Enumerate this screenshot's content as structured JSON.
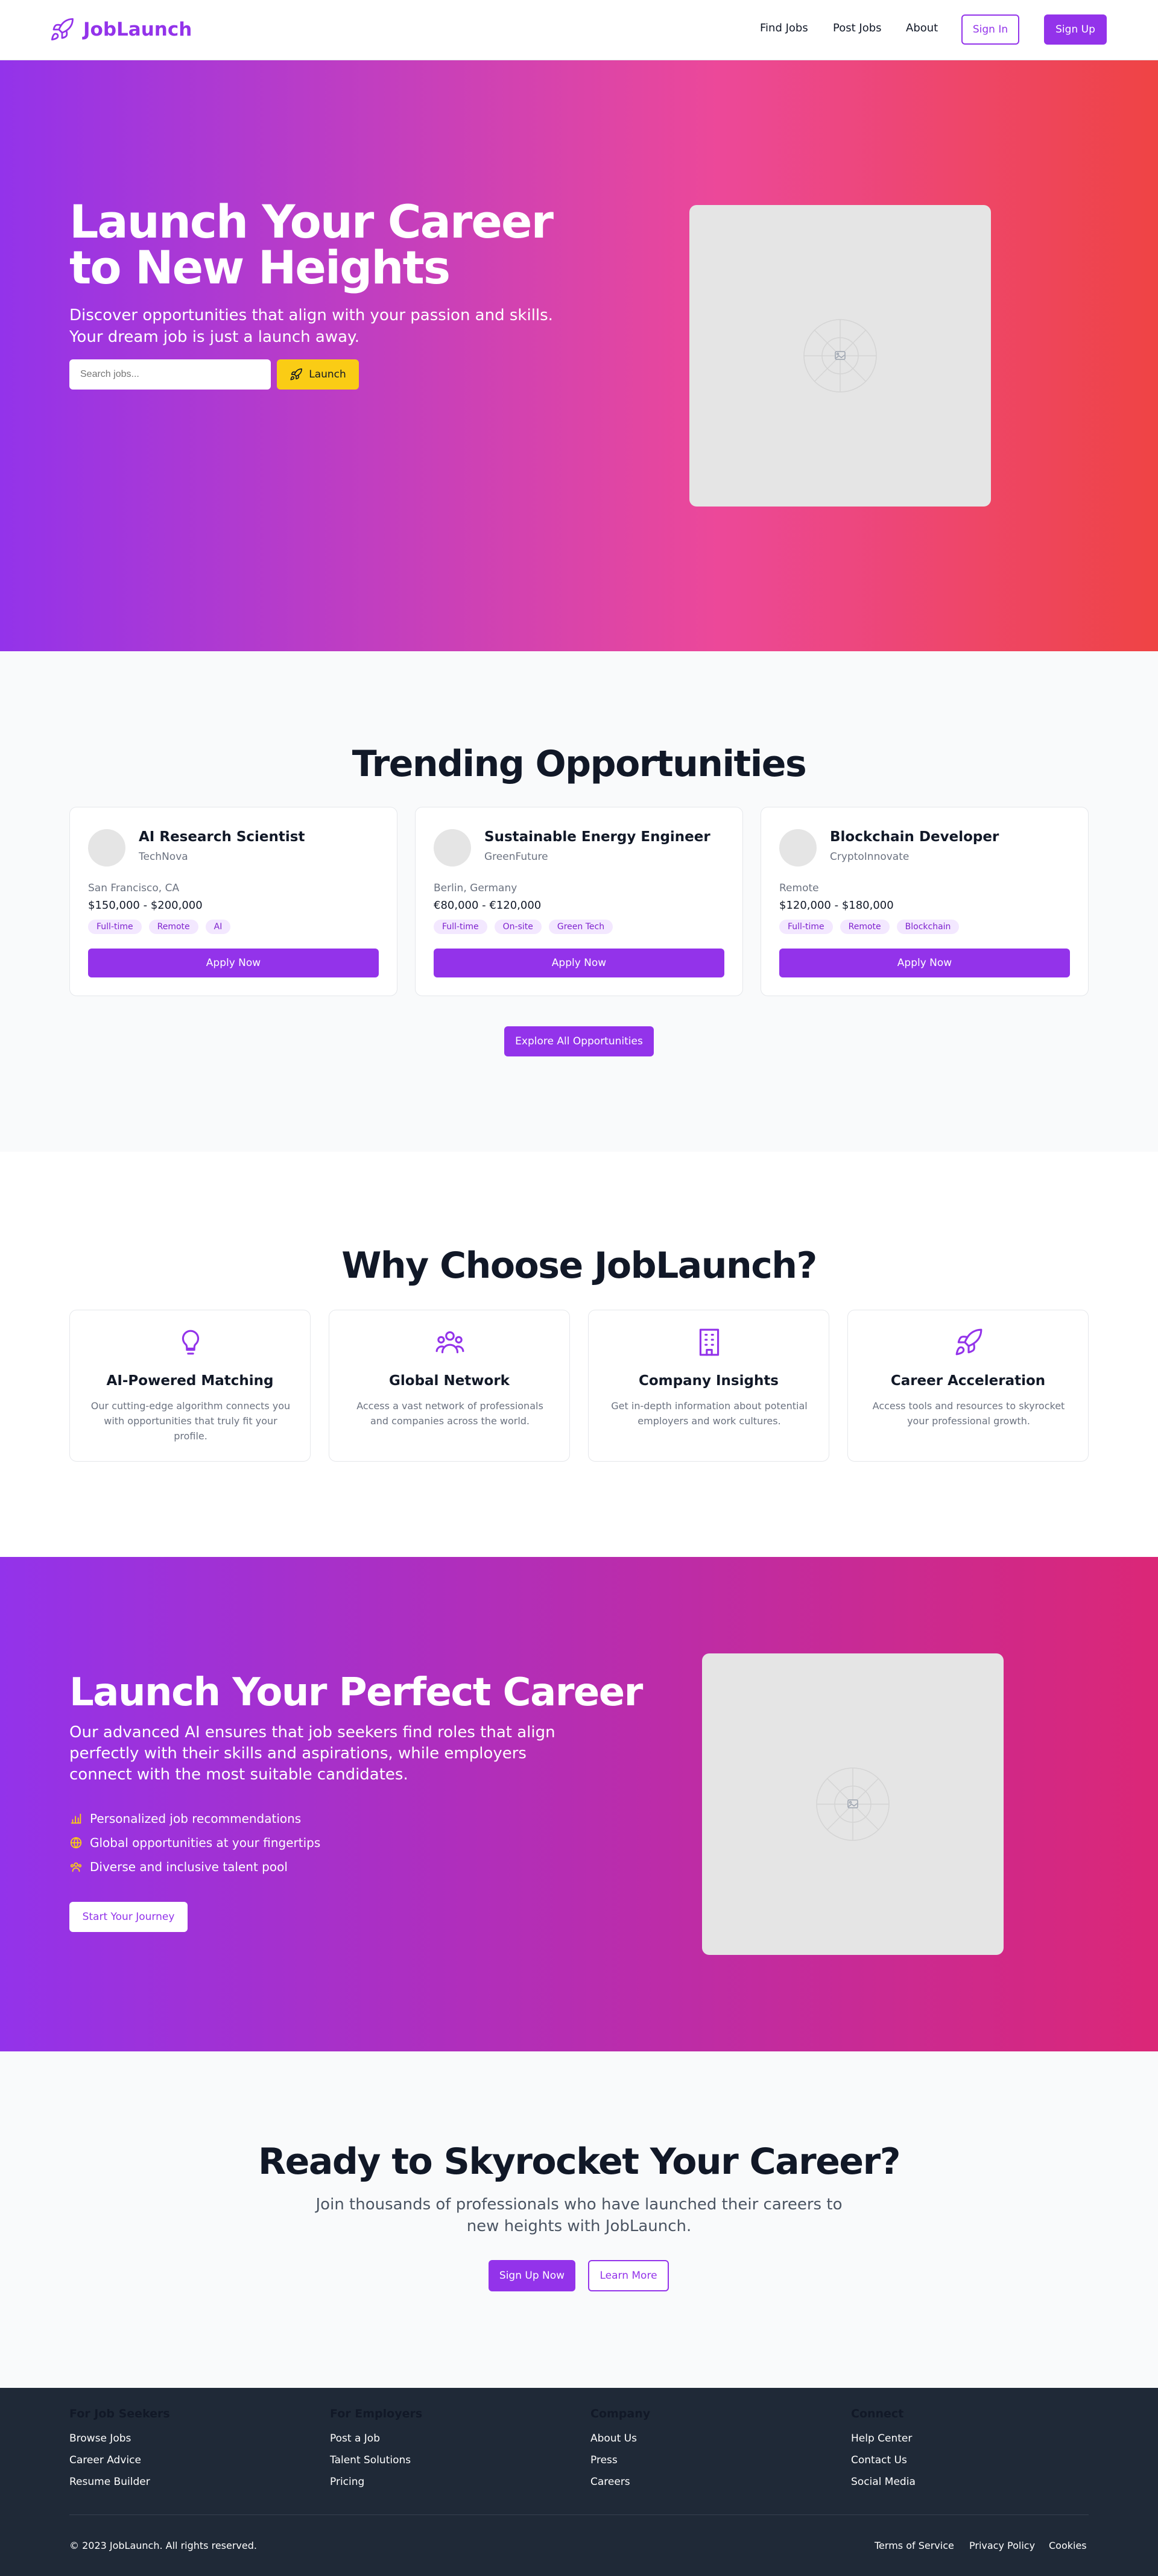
{
  "nav": {
    "brand": "JobLaunch",
    "links": [
      "Find Jobs",
      "Post Jobs",
      "About"
    ],
    "signin": "Sign In",
    "signup": "Sign Up"
  },
  "hero": {
    "title": "Launch Your Career to New Heights",
    "subtitle": "Discover opportunities that align with your passion and skills. Your dream job is just a launch away.",
    "search_placeholder": "Search jobs...",
    "button": "Launch"
  },
  "trending": {
    "title": "Trending Opportunities",
    "jobs": [
      {
        "title": "AI Research Scientist",
        "company": "TechNova",
        "location": "San Francisco, CA",
        "salary": "$150,000 - $200,000",
        "tags": [
          "Full-time",
          "Remote",
          "AI"
        ],
        "apply": "Apply Now"
      },
      {
        "title": "Sustainable Energy Engineer",
        "company": "GreenFuture",
        "location": "Berlin, Germany",
        "salary": "€80,000 - €120,000",
        "tags": [
          "Full-time",
          "On-site",
          "Green Tech"
        ],
        "apply": "Apply Now"
      },
      {
        "title": "Blockchain Developer",
        "company": "CryptoInnovate",
        "location": "Remote",
        "salary": "$120,000 - $180,000",
        "tags": [
          "Full-time",
          "Remote",
          "Blockchain"
        ],
        "apply": "Apply Now"
      }
    ],
    "explore": "Explore All Opportunities"
  },
  "why": {
    "title": "Why Choose JobLaunch?",
    "features": [
      {
        "icon": "lightbulb-icon",
        "title": "AI-Powered Matching",
        "desc": "Our cutting-edge algorithm connects you with opportunities that truly fit your profile."
      },
      {
        "icon": "users-icon",
        "title": "Global Network",
        "desc": "Access a vast network of professionals and companies across the world."
      },
      {
        "icon": "building-icon",
        "title": "Company Insights",
        "desc": "Get in-depth information about potential employers and work cultures."
      },
      {
        "icon": "rocket-icon",
        "title": "Career Acceleration",
        "desc": "Access tools and resources to skyrocket your professional growth."
      }
    ]
  },
  "perfect": {
    "title": "Launch Your Perfect Career",
    "subtitle": "Our advanced AI ensures that job seekers find roles that align perfectly with their skills and aspirations, while employers connect with the most suitable candidates.",
    "items": [
      {
        "icon": "chart-icon",
        "text": "Personalized job recommendations"
      },
      {
        "icon": "globe-icon",
        "text": "Global opportunities at your fingertips"
      },
      {
        "icon": "team-icon",
        "text": "Diverse and inclusive talent pool"
      }
    ],
    "button": "Start Your Journey"
  },
  "cta": {
    "title": "Ready to Skyrocket Your Career?",
    "subtitle": "Join thousands of professionals who have launched their careers to new heights with JobLaunch.",
    "signup": "Sign Up Now",
    "learn": "Learn More"
  },
  "footer": {
    "columns": [
      {
        "heading": "For Job Seekers",
        "links": [
          "Browse Jobs",
          "Career Advice",
          "Resume Builder"
        ]
      },
      {
        "heading": "For Employers",
        "links": [
          "Post a Job",
          "Talent Solutions",
          "Pricing"
        ]
      },
      {
        "heading": "Company",
        "links": [
          "About Us",
          "Press",
          "Careers"
        ]
      },
      {
        "heading": "Connect",
        "links": [
          "Help Center",
          "Contact Us",
          "Social Media"
        ]
      }
    ],
    "copyright": "© 2023 JobLaunch. All rights reserved.",
    "legal": [
      "Terms of Service",
      "Privacy Policy",
      "Cookies"
    ]
  },
  "colors": {
    "accent": "#9333ea",
    "pink": "#ec4899",
    "red": "#ef4444",
    "yellow": "#facc15",
    "footer": "#1f2937"
  }
}
